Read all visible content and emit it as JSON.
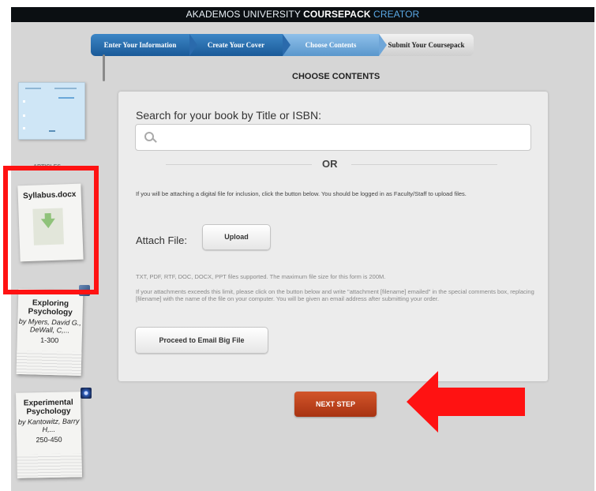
{
  "header": {
    "part1": "AKADEMOS UNIVERSITY",
    "part2": "COURSEPACK",
    "part3": "CREATOR"
  },
  "steps": [
    {
      "label": "Enter Your Information",
      "state": "done"
    },
    {
      "label": "Create Your Cover",
      "state": "done"
    },
    {
      "label": "Choose Contents",
      "state": "active"
    },
    {
      "label": "Submit Your Coursepack",
      "state": "pending"
    }
  ],
  "page_title": "CHOOSE CONTENTS",
  "sidebar": {
    "section_label": "ARTICLES",
    "uploaded_file": "Syllabus.docx",
    "books": [
      {
        "title": "Exploring Psychology",
        "author": "by Myers, David G., DeWall, C,...",
        "pages": "1-300"
      },
      {
        "title": "Experimental Psychology",
        "author": "by Kantowitz, Barry H,...",
        "pages": "250-450"
      }
    ]
  },
  "search": {
    "label": "Search for your book by Title or ISBN:",
    "value": "",
    "placeholder": ""
  },
  "or_text": "OR",
  "attach": {
    "info": "If you will be attaching a digital file for inclusion, click the button below. You should be logged in as Faculty/Staff to upload files.",
    "label": "Attach File:",
    "upload_button": "Upload",
    "supported": "TXT, PDF, RTF, DOC, DOCX, PPT files supported. The maximum file size for this form is 200M.",
    "exceeds": "If your attachments exceeds this limit, please click on the button below and write \"attachment [filename] emailed\" in the special comments box, replacing [filename] with the name of the file on your computer. You will be given an email address after submitting your order.",
    "email_button": "Proceed to Email Big File"
  },
  "next_button": "NEXT STEP",
  "colors": {
    "header_bg": "#0b0f12",
    "step_active": "#5a97cc",
    "step_done": "#1a5a98",
    "next_button": "#c1441f",
    "annotation": "#ff1212"
  }
}
